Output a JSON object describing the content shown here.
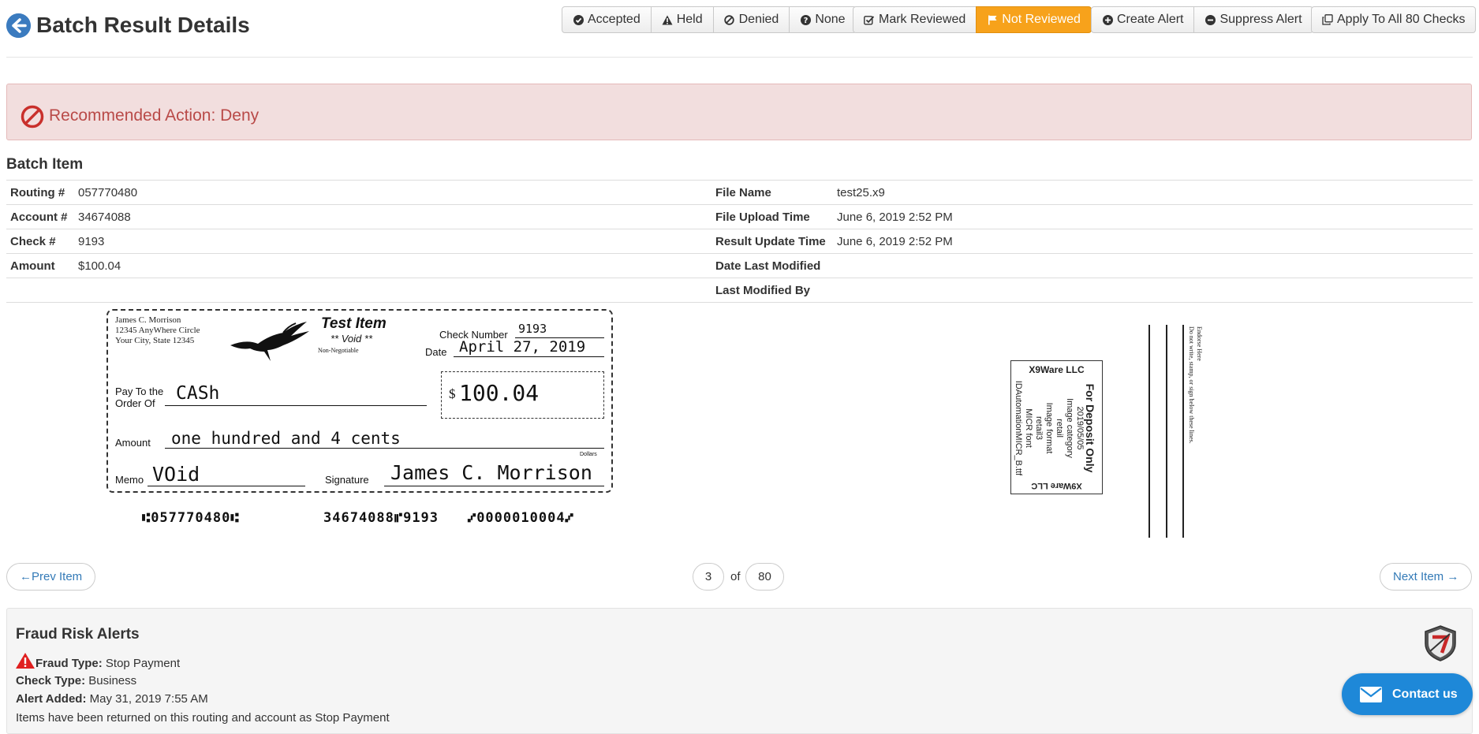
{
  "header": {
    "title": "Batch Result Details",
    "status_buttons": {
      "accepted": "Accepted",
      "held": "Held",
      "denied": "Denied",
      "none": "None"
    },
    "review_buttons": {
      "mark_reviewed": "Mark Reviewed",
      "not_reviewed": "Not Reviewed"
    },
    "alert_buttons": {
      "create_alert": "Create Alert",
      "suppress_alert": "Suppress Alert"
    },
    "apply_all": "Apply To All 80 Checks",
    "accent_color": "#f7a21b"
  },
  "recommendation": {
    "text": "Recommended Action: Deny",
    "color": "#b94a48"
  },
  "batch_item": {
    "title": "Batch Item",
    "left": [
      {
        "label": "Routing #",
        "value": "057770480"
      },
      {
        "label": "Account #",
        "value": "34674088"
      },
      {
        "label": "Check #",
        "value": "9193"
      },
      {
        "label": "Amount",
        "value": "$100.04"
      }
    ],
    "right": [
      {
        "label": "File Name",
        "value": "test25.x9"
      },
      {
        "label": "File Upload Time",
        "value": "June 6, 2019 2:52 PM"
      },
      {
        "label": "Result Update Time",
        "value": "June 6, 2019 2:52 PM"
      },
      {
        "label": "Date Last Modified",
        "value": ""
      },
      {
        "label": "Last Modified By",
        "value": ""
      }
    ]
  },
  "check": {
    "drawer_name": "James C. Morrison",
    "drawer_address1": "12345 AnyWhere Circle",
    "drawer_address2": "Your City, State 12345",
    "test_item": "Test Item",
    "void_label": "** Void **",
    "non_negotiable": "Non-Negotiable",
    "check_number_label": "Check Number",
    "check_number": "9193",
    "date_label": "Date",
    "date": "April 27, 2019",
    "pay_to_label1": "Pay To the",
    "pay_to_label2": "Order Of",
    "payee": "CASh",
    "dollar_sign": "$",
    "amount_numeric": "100.04",
    "amount_label": "Amount",
    "amount_words": "one hundred and 4 cents",
    "dollars_label": "Dollars",
    "memo_label": "Memo",
    "memo": "VOid",
    "signature_label": "Signature",
    "signature": "James C. Morrison",
    "micr_routing": "⑆057770480⑆",
    "micr_account": "34674088⑈9193",
    "micr_amount": "⑇0000010004⑇",
    "back": {
      "stamp_top": "X9Ware LLC",
      "stamp_lines": [
        "For Deposit Only",
        "2019/05/05",
        "Image category",
        "retail",
        "Image format",
        "retail3",
        "MICR font",
        "IDAutomationMICR_B.ttf"
      ],
      "stamp_bottom": "X9Ware LLC",
      "endorse_title": "Endorse Here",
      "endorse_note": "Do not write, stamp, or sign below these lines."
    }
  },
  "pager": {
    "prev": "←Prev Item",
    "next": "Next Item →",
    "current": "3",
    "of": "of",
    "total": "80"
  },
  "fraud": {
    "title": "Fraud Risk Alerts",
    "fraud_type_label": "Fraud Type:",
    "fraud_type": "Stop Payment",
    "check_type_label": "Check Type:",
    "check_type": "Business",
    "alert_added_label": "Alert Added:",
    "alert_added": "May 31, 2019 7:55 AM",
    "description": "Items have been returned on this routing and account as Stop Payment"
  },
  "contact": {
    "label": "Contact us",
    "color": "#1e88d8"
  }
}
